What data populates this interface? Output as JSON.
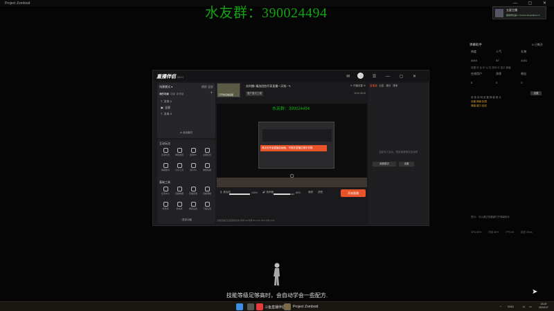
{
  "window": {
    "title": "Project Zomboid"
  },
  "watermark": "水友群：390024494",
  "user": {
    "name": "五星主播",
    "subtitle": "超级排位第1 / Curious Expeditions 2"
  },
  "helper": {
    "title": "弹幕助手",
    "status": "已断开",
    "stats": [
      {
        "label": "热度",
        "value": "4019"
      },
      {
        "label": "人气",
        "value": "57"
      },
      {
        "label": "礼物",
        "value": "4151"
      },
      {
        "label": "在线用户",
        "value": "0"
      },
      {
        "label": "消息",
        "value": "0"
      },
      {
        "label": "粉丝",
        "value": "0"
      }
    ],
    "notice": "设置 好 后 可 以 在 游戏 中 显示 弹幕",
    "tip_line1": "请 按 说 明 设 置 弹 幕 助 手",
    "tip_hl1": "设置 弹幕 权限",
    "tip_hl2": "弹幕 窗口 锁定",
    "tip_button": "设置",
    "separator": "提示：可以通过快捷键打开弹幕助手",
    "footer": [
      "CPU 50%",
      "内存 56%",
      "FPS 60",
      "延迟 25ms"
    ]
  },
  "app": {
    "logo": "直播伴侣",
    "version": "6314",
    "scene": {
      "header": "场景模式",
      "header_actions": [
        "横屏",
        "竖屏"
      ],
      "tabs": [
        "我的场景",
        "场景",
        "新场景"
      ],
      "items": [
        "文本 1",
        "全屏",
        "文本 2"
      ],
      "add_source": "添加素材"
    },
    "interact_label": "互动玩法",
    "interact_tools": [
      "互动玩法",
      "弹幕游戏",
      "连线PK",
      "主播任务",
      "弹幕助手",
      "分享工具",
      "观众PK",
      "弹幕投票"
    ],
    "assist_label": "基础工具",
    "assist_tools": [
      "任务中心",
      "直播数据",
      "直播回放",
      "直播课堂",
      "场景库",
      "素材库",
      "弹幕设置",
      "下播设置"
    ],
    "more": "更多功能",
    "room": {
      "thumb_label": "已开启直播画面",
      "title": "实时播! 精选怼脸尽享直播一天啦~",
      "category": "僵尸毁灭工程",
      "meta_top": "开播设置",
      "meta_bottom": "4019  4013"
    },
    "preview": {
      "overlay_watermark": "水友群：390024494",
      "alert": "请点击开始直播后画面，不能在直播过程中切换"
    },
    "controls": {
      "mic_label": "麦克风",
      "mic_value": "100%",
      "speaker_label": "扬声器",
      "speaker_value": "80%",
      "tool1": "美颜",
      "tool2": "滤镜",
      "start": "开始直播"
    },
    "statusline": "当前直播已设置满屏方向  码率 2M  帧率 30  CPU 30%  内存 54%",
    "right_tabs": [
      "直播通",
      "公告",
      "观众",
      "排序"
    ],
    "right_empty": "当前无人互动，快去邀请观众互动吧",
    "right_btn1": "观看模式",
    "right_btn2": "设置"
  },
  "game": {
    "subtitle": "技能等级足够高时，会自动学会一些配方."
  },
  "taskbar": {
    "apps": [
      "斗鱼直播伴侣",
      "Project Zomboid"
    ],
    "time": "23:29",
    "date": "2024/1/7",
    "lang": "ENG"
  }
}
